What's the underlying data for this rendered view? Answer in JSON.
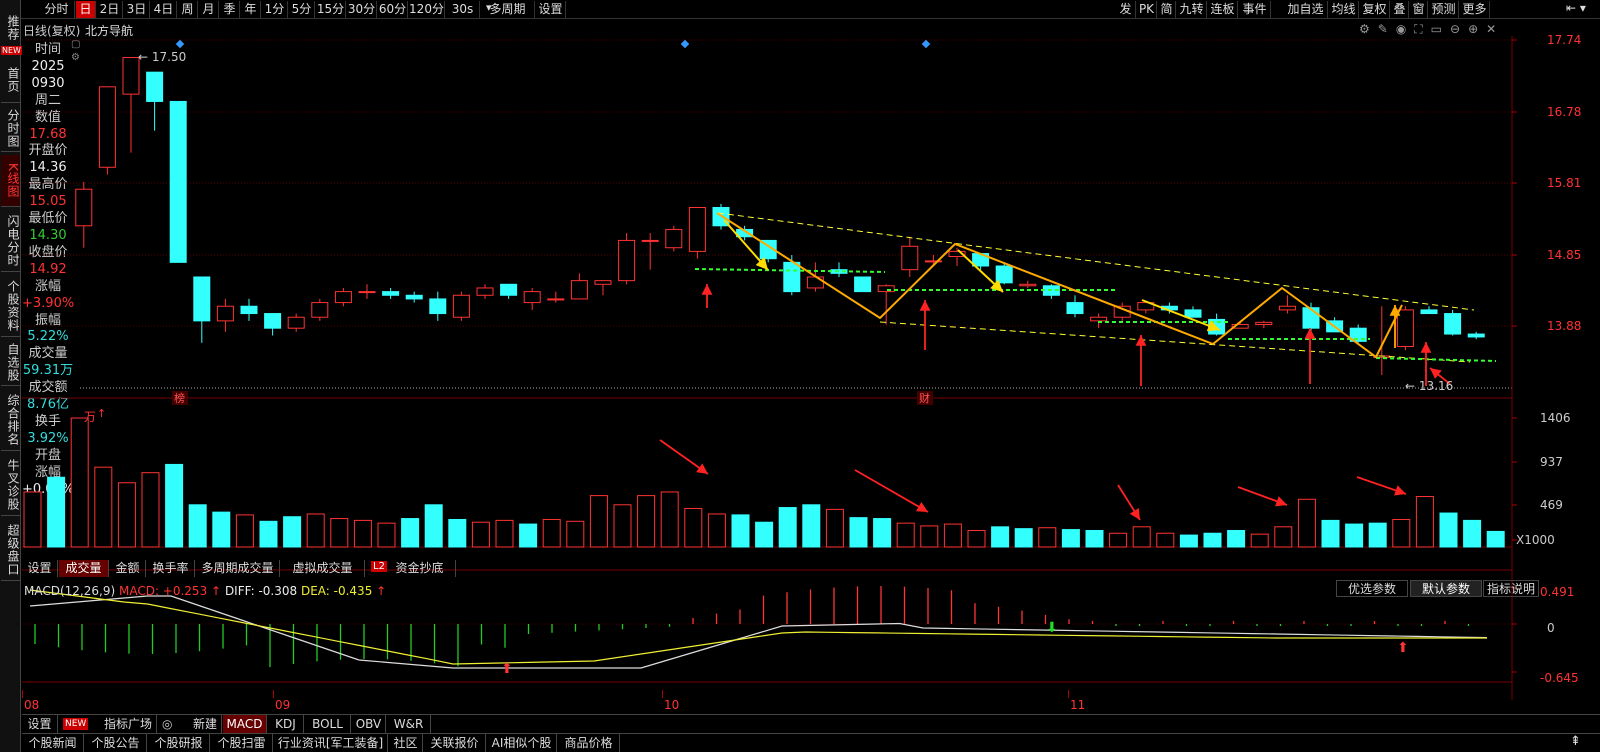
{
  "left_nav": [
    {
      "label": "推荐",
      "active": false
    },
    {
      "label": "首页",
      "active": false
    },
    {
      "label": "分时图",
      "active": false
    },
    {
      "label": "K线图",
      "active": true
    },
    {
      "label": "闪电分时",
      "active": false
    },
    {
      "label": "个股资料",
      "active": false
    },
    {
      "label": "自选股",
      "active": false
    },
    {
      "label": "综合排名",
      "active": false
    },
    {
      "label": "牛叉诊股",
      "active": false
    },
    {
      "label": "超级盘口",
      "active": false
    }
  ],
  "new_badge": "NEW",
  "toolbar": {
    "periods": [
      "分时",
      "日",
      "2日",
      "3日",
      "4日",
      "周",
      "月",
      "季",
      "年",
      "1分",
      "5分",
      "15分",
      "30分",
      "60分",
      "120分",
      "30s",
      "多周期",
      "设置"
    ],
    "active_period": "日",
    "right_items": [
      "发",
      "PK",
      "简",
      "九转",
      "连板",
      "事件",
      "加自选",
      "均线",
      "复权",
      "叠",
      "窗",
      "预测",
      "更多"
    ]
  },
  "chart_header": {
    "mode": "日线(复权)",
    "stock_name": "北方导航"
  },
  "info_panel": [
    {
      "label": "时间",
      "value": ""
    },
    {
      "label": "",
      "value": "2025"
    },
    {
      "label": "",
      "value": "0930"
    },
    {
      "label": "周二",
      "value": ""
    },
    {
      "label": "数值",
      "value": ""
    },
    {
      "label": "",
      "value": "17.68"
    },
    {
      "label": "开盘价",
      "value": ""
    },
    {
      "label": "",
      "value": "14.36"
    },
    {
      "label": "最高价",
      "value": ""
    },
    {
      "label": "",
      "value": "15.05"
    },
    {
      "label": "最低价",
      "value": ""
    },
    {
      "label": "",
      "value": "14.30"
    },
    {
      "label": "收盘价",
      "value": ""
    },
    {
      "label": "",
      "value": "14.92"
    },
    {
      "label": "涨幅",
      "value": ""
    },
    {
      "label": "",
      "value": "+3.90%"
    },
    {
      "label": "振幅",
      "value": ""
    },
    {
      "label": "",
      "value": "5.22%"
    },
    {
      "label": "成交量",
      "value": ""
    },
    {
      "label": "",
      "value": "59.31万"
    },
    {
      "label": "成交额",
      "value": ""
    },
    {
      "label": "",
      "value": "8.76亿"
    },
    {
      "label": "换手",
      "value": ""
    },
    {
      "label": "",
      "value": "3.92%"
    },
    {
      "label": "开盘",
      "value": ""
    },
    {
      "label": "涨幅",
      "value": ""
    },
    {
      "label": "",
      "value": "+0.00%"
    }
  ],
  "price_axis": [
    "17.74",
    "16.78",
    "15.81",
    "14.85",
    "13.88"
  ],
  "price_annotations": {
    "high": "17.50",
    "low": "13.16",
    "marker1": "榜",
    "marker2": "财"
  },
  "volume_axis": [
    "1406",
    "937",
    "469",
    "X1000"
  ],
  "volume_unit": "万",
  "volume_tabs": [
    "设置",
    "成交量",
    "金额",
    "换手率",
    "多周期成交量",
    "虚拟成交量",
    "资金抄底"
  ],
  "volume_tab_active": "成交量",
  "l2_badge": "L2",
  "macd": {
    "title": "MACD(12,26,9)",
    "macd_label": "MACD: +0.253",
    "diff_label": "DIFF: -0.308",
    "dea_label": "DEA: -0.435",
    "axis": [
      "0.491",
      "0",
      "-0.645"
    ],
    "buttons": [
      "优选参数",
      "默认参数",
      "指标说明"
    ],
    "button_active": "默认参数"
  },
  "date_axis": [
    "08",
    "09",
    "10",
    "11"
  ],
  "indicator_tabs": [
    "设置",
    "指标广场",
    "新建",
    "MACD",
    "KDJ",
    "BOLL",
    "OBV",
    "W&R"
  ],
  "indicator_tab_active": "MACD",
  "news_tabs": [
    "个股新闻",
    "个股公告",
    "个股研报",
    "个股扫雷",
    "行业资讯[军工装备]",
    "社区",
    "关联报价",
    "AI相似个股",
    "商品价格"
  ],
  "colors": {
    "up": "#ff3333",
    "down": "#33ffff",
    "annotation": "#ffaa00",
    "channel": "#ffff33",
    "support": "#33ff33",
    "arrow": "#ff2222"
  },
  "chart_data": {
    "type": "candlestick",
    "price_range": [
      13.16,
      17.74
    ],
    "candles": [
      {
        "o": 15.2,
        "h": 15.8,
        "l": 14.9,
        "c": 15.7
      },
      {
        "o": 16.0,
        "h": 17.1,
        "l": 15.9,
        "c": 17.1
      },
      {
        "o": 17.0,
        "h": 17.5,
        "l": 16.2,
        "c": 17.5
      },
      {
        "o": 17.3,
        "h": 17.3,
        "l": 16.5,
        "c": 16.9
      },
      {
        "o": 16.9,
        "h": 16.9,
        "l": 14.7,
        "c": 14.7
      },
      {
        "o": 14.5,
        "h": 14.5,
        "l": 13.6,
        "c": 13.9
      },
      {
        "o": 13.9,
        "h": 14.2,
        "l": 13.75,
        "c": 14.1
      },
      {
        "o": 14.1,
        "h": 14.2,
        "l": 13.9,
        "c": 14.0
      },
      {
        "o": 14.0,
        "h": 14.0,
        "l": 13.7,
        "c": 13.8
      },
      {
        "o": 13.8,
        "h": 14.0,
        "l": 13.75,
        "c": 13.95
      },
      {
        "o": 13.95,
        "h": 14.2,
        "l": 13.9,
        "c": 14.15
      },
      {
        "o": 14.15,
        "h": 14.35,
        "l": 14.1,
        "c": 14.3
      },
      {
        "o": 14.3,
        "h": 14.4,
        "l": 14.2,
        "c": 14.3
      },
      {
        "o": 14.3,
        "h": 14.35,
        "l": 14.2,
        "c": 14.25
      },
      {
        "o": 14.25,
        "h": 14.3,
        "l": 14.15,
        "c": 14.2
      },
      {
        "o": 14.2,
        "h": 14.3,
        "l": 13.9,
        "c": 14.0
      },
      {
        "o": 13.95,
        "h": 14.3,
        "l": 13.9,
        "c": 14.25
      },
      {
        "o": 14.25,
        "h": 14.4,
        "l": 14.2,
        "c": 14.35
      },
      {
        "o": 14.4,
        "h": 14.4,
        "l": 14.2,
        "c": 14.25
      },
      {
        "o": 14.15,
        "h": 14.35,
        "l": 14.05,
        "c": 14.3
      },
      {
        "o": 14.2,
        "h": 14.3,
        "l": 14.15,
        "c": 14.2
      },
      {
        "o": 14.2,
        "h": 14.55,
        "l": 14.2,
        "c": 14.45
      },
      {
        "o": 14.4,
        "h": 14.45,
        "l": 14.25,
        "c": 14.45
      },
      {
        "o": 14.45,
        "h": 15.1,
        "l": 14.4,
        "c": 15.0
      },
      {
        "o": 15.0,
        "h": 15.1,
        "l": 14.6,
        "c": 15.0
      },
      {
        "o": 14.9,
        "h": 15.2,
        "l": 14.85,
        "c": 15.15
      },
      {
        "o": 14.85,
        "h": 15.45,
        "l": 14.75,
        "c": 15.45
      },
      {
        "o": 15.45,
        "h": 15.5,
        "l": 15.15,
        "c": 15.2
      },
      {
        "o": 15.15,
        "h": 15.2,
        "l": 15.0,
        "c": 15.05
      },
      {
        "o": 15.0,
        "h": 15.0,
        "l": 14.7,
        "c": 14.75
      },
      {
        "o": 14.7,
        "h": 14.8,
        "l": 14.25,
        "c": 14.3
      },
      {
        "o": 14.35,
        "h": 14.7,
        "l": 14.3,
        "c": 14.5
      },
      {
        "o": 14.6,
        "h": 14.7,
        "l": 14.5,
        "c": 14.55
      },
      {
        "o": 14.5,
        "h": 14.5,
        "l": 14.3,
        "c": 14.3
      },
      {
        "o": 14.3,
        "h": 14.4,
        "l": 13.85,
        "c": 14.38
      },
      {
        "o": 14.6,
        "h": 15.05,
        "l": 14.5,
        "c": 14.92
      },
      {
        "o": 14.72,
        "h": 14.8,
        "l": 14.65,
        "c": 14.72
      },
      {
        "o": 14.78,
        "h": 14.9,
        "l": 14.65,
        "c": 14.85
      },
      {
        "o": 14.82,
        "h": 14.82,
        "l": 14.6,
        "c": 14.65
      },
      {
        "o": 14.65,
        "h": 14.7,
        "l": 14.4,
        "c": 14.42
      },
      {
        "o": 14.38,
        "h": 14.45,
        "l": 14.35,
        "c": 14.4
      },
      {
        "o": 14.38,
        "h": 14.4,
        "l": 14.2,
        "c": 14.25
      },
      {
        "o": 14.15,
        "h": 14.25,
        "l": 13.95,
        "c": 14.0
      },
      {
        "o": 13.9,
        "h": 14.0,
        "l": 13.8,
        "c": 13.95
      },
      {
        "o": 13.95,
        "h": 14.15,
        "l": 13.9,
        "c": 14.1
      },
      {
        "o": 14.05,
        "h": 14.15,
        "l": 14.0,
        "c": 14.15
      },
      {
        "o": 14.1,
        "h": 14.15,
        "l": 14.0,
        "c": 14.05
      },
      {
        "o": 14.05,
        "h": 14.1,
        "l": 13.95,
        "c": 13.95
      },
      {
        "o": 13.92,
        "h": 14.0,
        "l": 13.7,
        "c": 13.72
      },
      {
        "o": 13.8,
        "h": 13.9,
        "l": 13.8,
        "c": 13.85
      },
      {
        "o": 13.85,
        "h": 13.9,
        "l": 13.8,
        "c": 13.88
      },
      {
        "o": 14.05,
        "h": 14.25,
        "l": 14.0,
        "c": 14.1
      },
      {
        "o": 14.08,
        "h": 14.15,
        "l": 13.75,
        "c": 13.8
      },
      {
        "o": 13.9,
        "h": 13.95,
        "l": 13.75,
        "c": 13.75
      },
      {
        "o": 13.8,
        "h": 13.85,
        "l": 13.6,
        "c": 13.62
      },
      {
        "o": 13.4,
        "h": 14.1,
        "l": 13.16,
        "c": 13.42
      },
      {
        "o": 13.55,
        "h": 14.1,
        "l": 13.5,
        "c": 14.05
      },
      {
        "o": 14.05,
        "h": 14.1,
        "l": 14.0,
        "c": 14.0
      },
      {
        "o": 14.0,
        "h": 14.05,
        "l": 13.7,
        "c": 13.72
      },
      {
        "o": 13.72,
        "h": 13.75,
        "l": 13.65,
        "c": 13.68
      }
    ],
    "volume_range": [
      0,
      1406
    ],
    "volumes": [
      600,
      760,
      1406,
      870,
      700,
      810,
      900,
      460,
      380,
      350,
      280,
      330,
      360,
      310,
      290,
      260,
      310,
      460,
      300,
      270,
      290,
      250,
      300,
      280,
      560,
      460,
      560,
      600,
      420,
      360,
      350,
      270,
      430,
      460,
      410,
      320,
      310,
      260,
      230,
      250,
      180,
      220,
      200,
      210,
      190,
      180,
      150,
      220,
      150,
      130,
      150,
      180,
      140,
      220,
      520,
      290,
      250,
      260,
      300,
      550,
      370,
      290,
      170
    ],
    "macd_range": [
      -0.645,
      0.491
    ]
  }
}
